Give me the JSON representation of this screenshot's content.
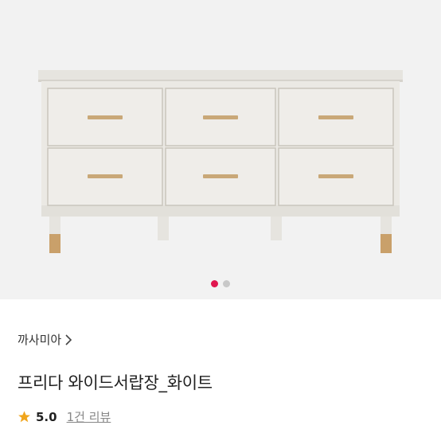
{
  "product": {
    "brand": "까사미아",
    "title": "프리다 와이드서랍장_화이트",
    "rating": "5.0",
    "reviews": "1건 리뷰"
  },
  "gallery": {
    "image_count": 2,
    "active_index": 0,
    "colors": {
      "active_dot": "#e0174f",
      "inactive_dot": "#c8c8c8",
      "background": "#f2f2f2"
    }
  },
  "icons": {
    "brand_chevron": "chevron-right-icon",
    "rating_star": "star-icon"
  },
  "colors": {
    "star": "#f0a51c"
  }
}
